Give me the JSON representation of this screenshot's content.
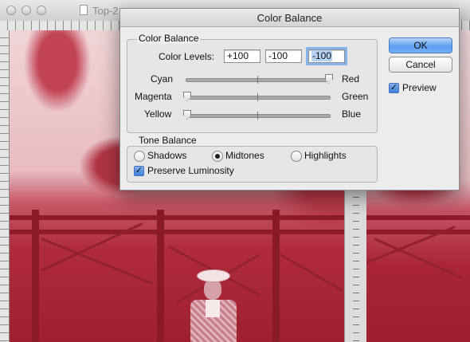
{
  "document_window": {
    "title": "Top-2"
  },
  "dialog": {
    "title": "Color Balance",
    "color_balance_group": {
      "legend": "Color Balance",
      "levels_label": "Color Levels:",
      "levels": [
        "+100",
        "-100",
        "-100"
      ],
      "sliders": [
        {
          "left": "Cyan",
          "right": "Red",
          "value": 100
        },
        {
          "left": "Magenta",
          "right": "Green",
          "value": -100
        },
        {
          "left": "Yellow",
          "right": "Blue",
          "value": -100
        }
      ]
    },
    "tone_balance_group": {
      "legend": "Tone Balance",
      "options": [
        {
          "label": "Shadows",
          "selected": false
        },
        {
          "label": "Midtones",
          "selected": true
        },
        {
          "label": "Highlights",
          "selected": false
        }
      ],
      "preserve_luminosity": {
        "label": "Preserve Luminosity",
        "checked": true
      }
    },
    "buttons": {
      "ok": "OK",
      "cancel": "Cancel"
    },
    "preview": {
      "label": "Preview",
      "checked": true
    }
  },
  "colors": {
    "accent_blue": "#5c9ff0",
    "photo_red": "#a0202f"
  }
}
